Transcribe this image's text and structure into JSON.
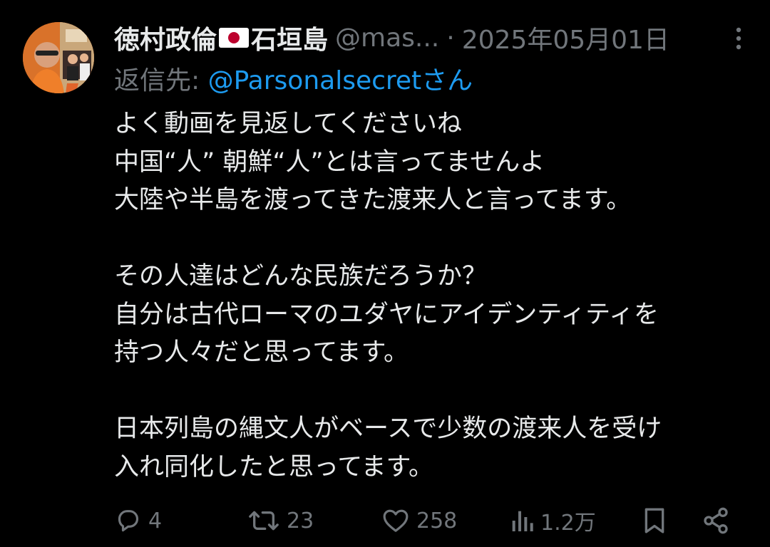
{
  "tweet": {
    "author": {
      "display_name_part1": "徳村政倫",
      "flag_icon": "japan-flag-icon",
      "display_name_part2": "石垣島",
      "handle": "@mas...",
      "separator": "·",
      "date": "2025年05月01日"
    },
    "reply_to": {
      "prefix": "返信先: ",
      "mention": "@Parsonalsecretさん"
    },
    "body_lines": [
      "よく動画を見返してくださいね",
      "中国“人” 朝鮮“人”とは言ってませんよ",
      "大陸や半島を渡ってきた渡来人と言ってます。",
      "",
      "その人達はどんな民族だろうか？",
      "自分は古代ローマのユダヤにアイデンティティを",
      "持つ人々だと思ってます。",
      "",
      "日本列島の縄文人がベースで少数の渡来人を受け",
      "入れ同化したと思ってます。"
    ],
    "actions": {
      "reply": {
        "icon": "reply-icon",
        "count": "4"
      },
      "retweet": {
        "icon": "retweet-icon",
        "count": "23"
      },
      "like": {
        "icon": "heart-icon",
        "count": "258"
      },
      "views": {
        "icon": "views-icon",
        "count": "1.2万"
      },
      "bookmark": {
        "icon": "bookmark-icon"
      },
      "share": {
        "icon": "share-icon"
      }
    }
  },
  "colors": {
    "background": "#000000",
    "text": "#e7e9ea",
    "secondary": "#71767b",
    "link": "#1d9bf0",
    "avatar_accent": "#d9722a",
    "flag_red": "#bc002d"
  }
}
